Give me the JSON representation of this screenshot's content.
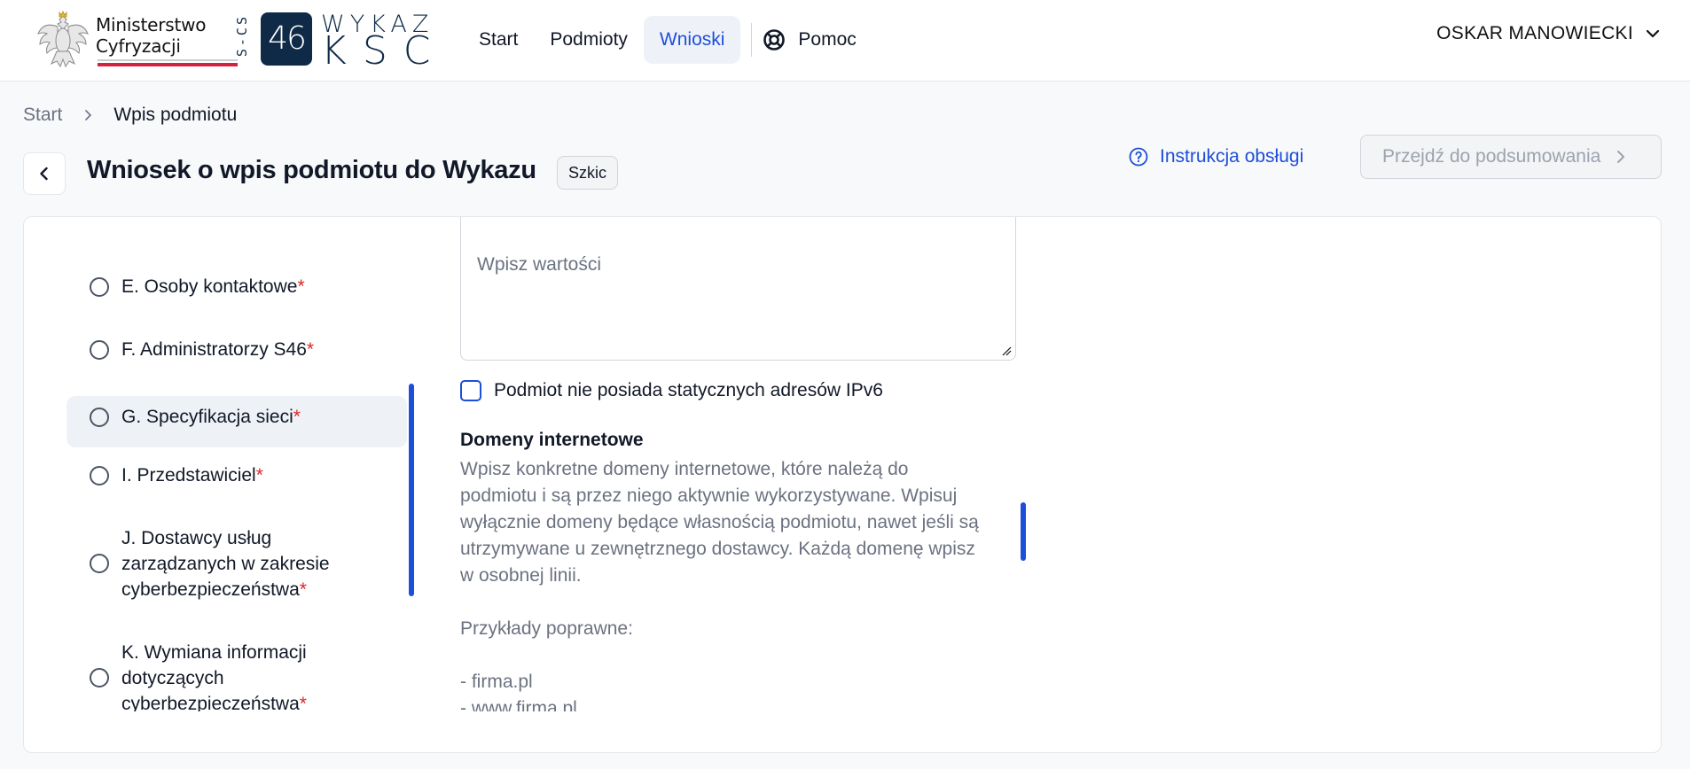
{
  "header": {
    "ministry_line1": "Ministerstwo",
    "ministry_line2": "Cyfryzacji",
    "ksc_vertical": "S-CS",
    "ksc_box": "46",
    "ksc_wykaz": "WYKAZ",
    "ksc_ksc": "KSC",
    "nav": [
      {
        "label": "Start",
        "active": false
      },
      {
        "label": "Podmioty",
        "active": false
      },
      {
        "label": "Wnioski",
        "active": true
      }
    ],
    "help_label": "Pomoc",
    "user_name": "OSKAR MANOWIECKI"
  },
  "breadcrumb": {
    "items": [
      "Start",
      "Wpis podmiotu"
    ]
  },
  "title": {
    "text": "Wniosek o wpis podmiotu do Wykazu",
    "status": "Szkic",
    "manual_link": "Instrukcja obsługi",
    "summary_button": "Przejdź do podsumowania"
  },
  "steps": [
    {
      "label": "E. Osoby kontaktowe",
      "required": "*",
      "active": false
    },
    {
      "label": "F. Administratorzy S46",
      "required": "*",
      "active": false
    },
    {
      "label": "G. Specyfikacja sieci",
      "required": "*",
      "active": true
    },
    {
      "label": "I. Przedstawiciel",
      "required": "*",
      "active": false
    },
    {
      "label_lines": [
        "J. Dostawcy usług",
        "zarządzanych w zakresie",
        "cyberbezpieczeństwa"
      ],
      "required": "*",
      "active": false
    },
    {
      "label_lines": [
        "K. Wymiana informacji",
        "dotyczących",
        "cyberbezpieczeństwa"
      ],
      "required": "*",
      "active": false
    }
  ],
  "form": {
    "textarea_placeholder": "Wpisz wartości",
    "ipv6_checkbox_label": "Podmiot nie posiada statycznych adresów IPv6",
    "ipv6_checked": false,
    "domains_title": "Domeny internetowe",
    "domains_help_lines": [
      "Wpisz konkretne domeny internetowe, które należą do",
      "podmiotu i są przez niego aktywnie wykorzystywane. Wpisuj",
      "wyłącznie domeny będące własnością podmiotu, nawet jeśli są",
      "utrzymywane u zewnętrznego dostawcy. Każdą domenę wpisz",
      "w osobnej linii."
    ],
    "examples_title": "Przykłady poprawne:",
    "examples": [
      "- firma.pl",
      "- www.firma.pl"
    ]
  },
  "colors": {
    "accent": "#1d4ed8",
    "required": "#dc2626",
    "brand_navy": "#0f2a47",
    "ministry_red": "#d4213d"
  }
}
